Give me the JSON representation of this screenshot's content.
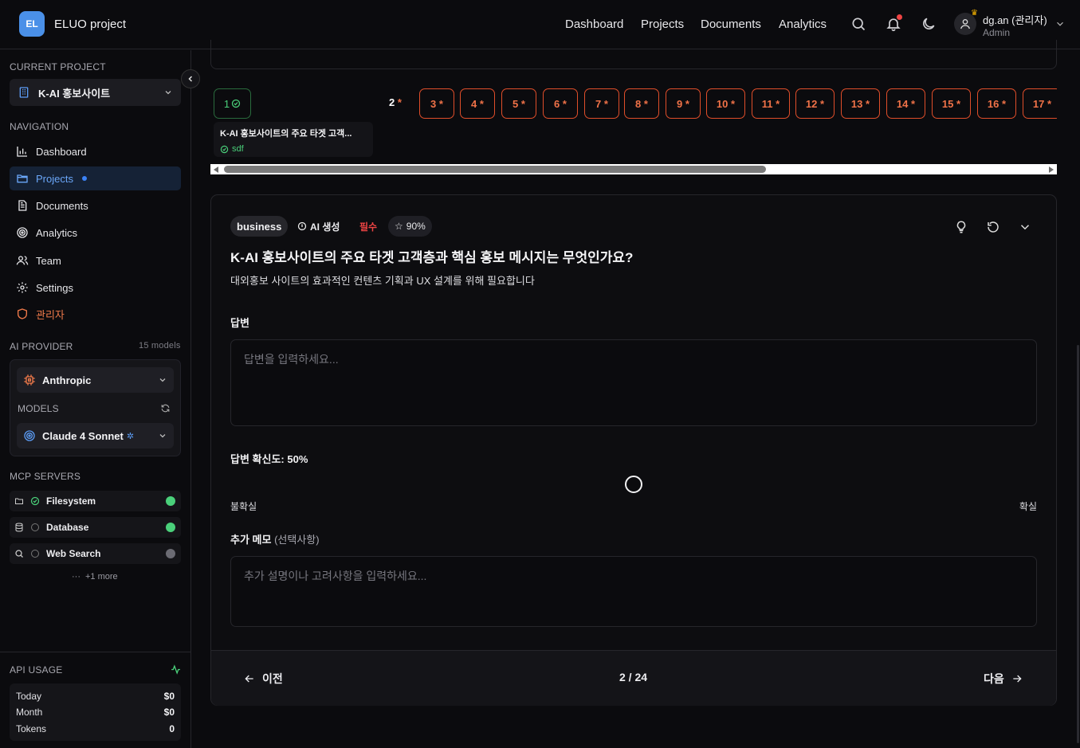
{
  "header": {
    "logo": "EL",
    "app_name": "ELUO project",
    "nav": [
      "Dashboard",
      "Projects",
      "Documents",
      "Analytics"
    ],
    "user_name": "dg.an (관리자)",
    "user_role": "Admin"
  },
  "sidebar": {
    "current_project_label": "CURRENT PROJECT",
    "project_name": "K-AI 홍보사이트",
    "navigation_label": "NAVIGATION",
    "nav_items": [
      "Dashboard",
      "Projects",
      "Documents",
      "Analytics",
      "Team",
      "Settings",
      "관리자"
    ],
    "active_item": "Projects",
    "ai_provider_label": "AI PROVIDER",
    "model_count": "15 models",
    "provider": "Anthropic",
    "models_label": "MODELS",
    "model": "Claude 4 Sonnet",
    "mcp_label": "MCP SERVERS",
    "mcp_servers": [
      {
        "name": "Filesystem",
        "status": "connected"
      },
      {
        "name": "Database",
        "status": "connected"
      },
      {
        "name": "Web Search",
        "status": "disconnected"
      }
    ],
    "mcp_more": "+1 more",
    "api_usage_label": "API USAGE",
    "usage": [
      {
        "label": "Today",
        "value": "$0"
      },
      {
        "label": "Month",
        "value": "$0"
      },
      {
        "label": "Tokens",
        "value": "0"
      }
    ]
  },
  "stepper": {
    "step1_label": "1",
    "current_step": "2",
    "required_mark": "*",
    "steps": [
      "3",
      "4",
      "5",
      "6",
      "7",
      "8",
      "9",
      "10",
      "11",
      "12",
      "13",
      "14",
      "15",
      "16",
      "17"
    ],
    "step1_title": "K-AI 홍보사이트의 주요 타겟 고객...",
    "step1_answer": "sdf"
  },
  "question": {
    "category": "business",
    "ai_tag": "AI 생성",
    "required_tag": "필수",
    "confidence_tag": "90%",
    "title": "K-AI 홍보사이트의 주요 타겟 고객층과 핵심 홍보 메시지는 무엇인가요?",
    "description": "대외홍보 사이트의 효과적인 컨텐츠 기획과 UX 설계를 위해 필요합니다",
    "answer_label": "답변",
    "answer_placeholder": "답변을 입력하세요...",
    "certainty_label": "답변 확신도: 50%",
    "certainty_value": 0.5,
    "certainty_min": "불확실",
    "certainty_max": "확실",
    "memo_label": "추가 메모",
    "memo_optional": "(선택사항)",
    "memo_placeholder": "추가 설명이나 고려사항을 입력하세요...",
    "prev": "이전",
    "next": "다음",
    "progress": "2 / 24"
  },
  "colors": {
    "accent": "#3b82f6",
    "required": "#f07248",
    "success": "#4ad07a",
    "danger": "#ef4444"
  }
}
